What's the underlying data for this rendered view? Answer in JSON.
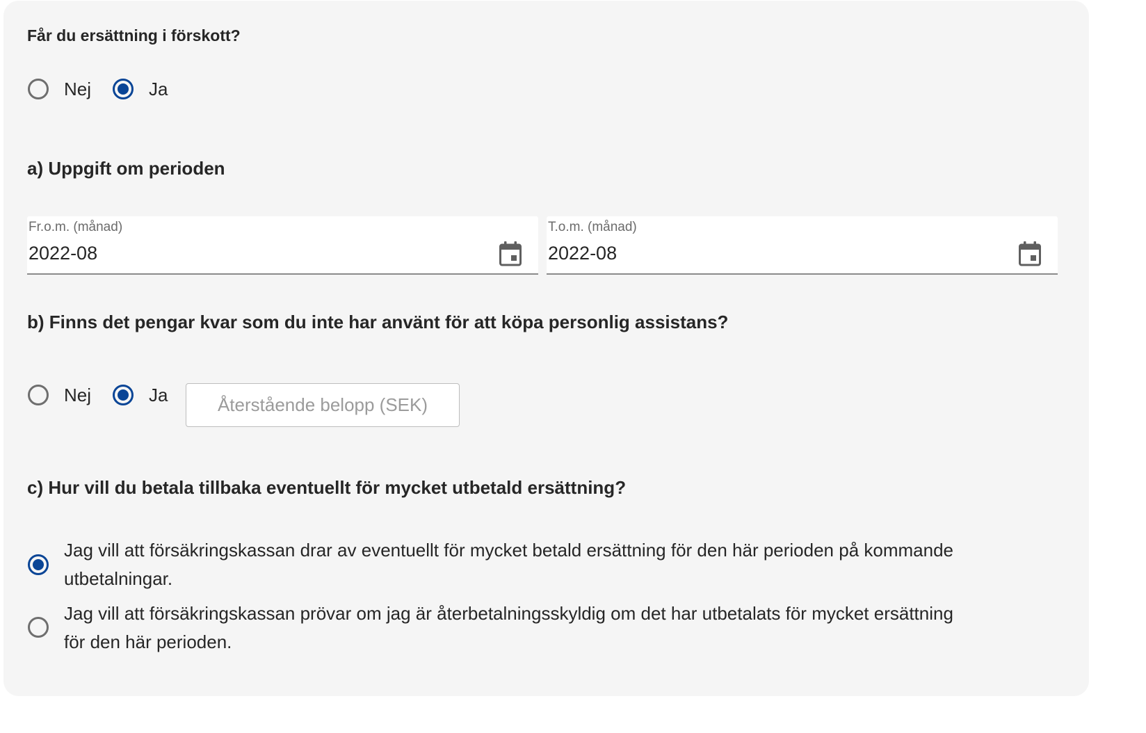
{
  "q_advance": {
    "title": "Får du ersättning i förskott?",
    "options": [
      {
        "label": "Nej",
        "selected": false
      },
      {
        "label": "Ja",
        "selected": true
      }
    ]
  },
  "section_a": {
    "title": "a) Uppgift om perioden",
    "from": {
      "label": "Fr.o.m. (månad)",
      "value": "2022-08",
      "icon": "calendar-icon"
    },
    "to": {
      "label": "T.o.m. (månad)",
      "value": "2022-08",
      "icon": "calendar-icon"
    }
  },
  "section_b": {
    "title": "b) Finns det pengar kvar som du inte har använt för att köpa personlig assistans?",
    "options": [
      {
        "label": "Nej",
        "selected": false
      },
      {
        "label": "Ja",
        "selected": true
      }
    ],
    "amount": {
      "value": "",
      "placeholder": "Återstående belopp (SEK)"
    }
  },
  "section_c": {
    "title": "c) Hur vill du betala tillbaka eventuellt för mycket utbetald ersättning?",
    "options": [
      {
        "line1": "Jag vill att försäkringskassan drar av eventuellt för mycket betald ersättning för den här perioden på kommande",
        "line2": "utbetalningar.",
        "selected": true
      },
      {
        "line1": "Jag vill att försäkringskassan prövar om jag är återbetalningsskyldig om det har utbetalats för mycket ersättning",
        "line2": "för den här perioden.",
        "selected": false
      }
    ]
  },
  "colors": {
    "accent": "#0a4596",
    "panel_background": "#f5f5f5",
    "text": "#262626",
    "muted_label": "#6b6b6b",
    "placeholder": "#9b9b9b"
  }
}
